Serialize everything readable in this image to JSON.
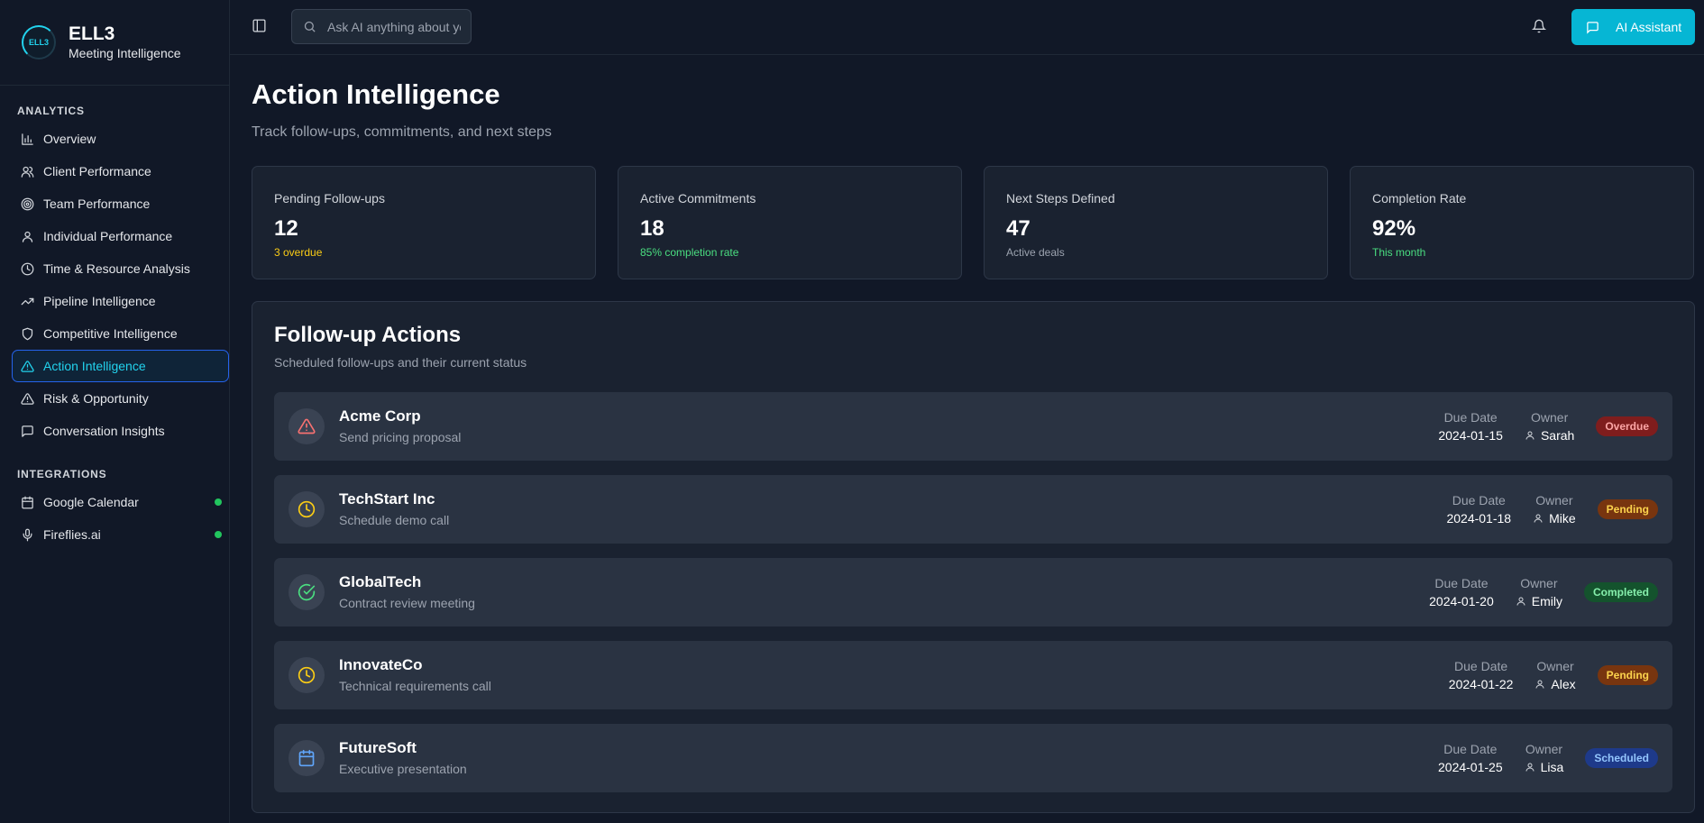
{
  "brand": {
    "logo_text": "ELL3",
    "name": "ELL3",
    "subtitle": "Meeting Intelligence"
  },
  "sidebar": {
    "analytics_label": "ANALYTICS",
    "items": [
      {
        "label": "Overview",
        "icon": "bar-chart-icon"
      },
      {
        "label": "Client Performance",
        "icon": "users-icon"
      },
      {
        "label": "Team Performance",
        "icon": "target-icon"
      },
      {
        "label": "Individual Performance",
        "icon": "user-icon"
      },
      {
        "label": "Time & Resource Analysis",
        "icon": "clock-icon"
      },
      {
        "label": "Pipeline Intelligence",
        "icon": "trending-up-icon"
      },
      {
        "label": "Competitive Intelligence",
        "icon": "shield-icon"
      },
      {
        "label": "Action Intelligence",
        "icon": "alert-triangle-icon",
        "active": true
      },
      {
        "label": "Risk & Opportunity",
        "icon": "alert-triangle-icon"
      },
      {
        "label": "Conversation Insights",
        "icon": "message-icon"
      }
    ],
    "integrations_label": "INTEGRATIONS",
    "integrations": [
      {
        "label": "Google Calendar",
        "icon": "calendar-icon",
        "status": "connected"
      },
      {
        "label": "Fireflies.ai",
        "icon": "microphone-icon",
        "status": "connected"
      }
    ]
  },
  "topbar": {
    "search_placeholder": "Ask AI anything about your meetings...",
    "ai_button_label": "AI Assistant"
  },
  "page": {
    "title": "Action Intelligence",
    "subtitle": "Track follow-ups, commitments, and next steps"
  },
  "stats": [
    {
      "label": "Pending Follow-ups",
      "value": "12",
      "note": "3 overdue",
      "note_color": "#facc15"
    },
    {
      "label": "Active Commitments",
      "value": "18",
      "note": "85% completion rate",
      "note_color": "#4ade80"
    },
    {
      "label": "Next Steps Defined",
      "value": "47",
      "note": "Active deals",
      "note_color": "#9ca3af"
    },
    {
      "label": "Completion Rate",
      "value": "92%",
      "note": "This month",
      "note_color": "#4ade80"
    }
  ],
  "followups": {
    "title": "Follow-up Actions",
    "subtitle": "Scheduled follow-ups and their current status",
    "due_label": "Due Date",
    "owner_label": "Owner",
    "rows": [
      {
        "company": "Acme Corp",
        "task": "Send pricing proposal",
        "due": "2024-01-15",
        "owner": "Sarah",
        "status": "Overdue",
        "icon": "alert-triangle-icon"
      },
      {
        "company": "TechStart Inc",
        "task": "Schedule demo call",
        "due": "2024-01-18",
        "owner": "Mike",
        "status": "Pending",
        "icon": "clock-icon"
      },
      {
        "company": "GlobalTech",
        "task": "Contract review meeting",
        "due": "2024-01-20",
        "owner": "Emily",
        "status": "Completed",
        "icon": "check-circle-icon"
      },
      {
        "company": "InnovateCo",
        "task": "Technical requirements call",
        "due": "2024-01-22",
        "owner": "Alex",
        "status": "Pending",
        "icon": "clock-icon"
      },
      {
        "company": "FutureSoft",
        "task": "Executive presentation",
        "due": "2024-01-25",
        "owner": "Lisa",
        "status": "Scheduled",
        "icon": "calendar-icon"
      }
    ]
  },
  "colors": {
    "accent": "#06b6d4",
    "overdue_bg": "#7f1d1d",
    "overdue_fg": "#fca5a5",
    "pending_bg": "#78350f",
    "pending_fg": "#fcd34d",
    "completed_bg": "#14532d",
    "completed_fg": "#86efac",
    "scheduled_bg": "#1e3a8a",
    "scheduled_fg": "#93c5fd"
  }
}
